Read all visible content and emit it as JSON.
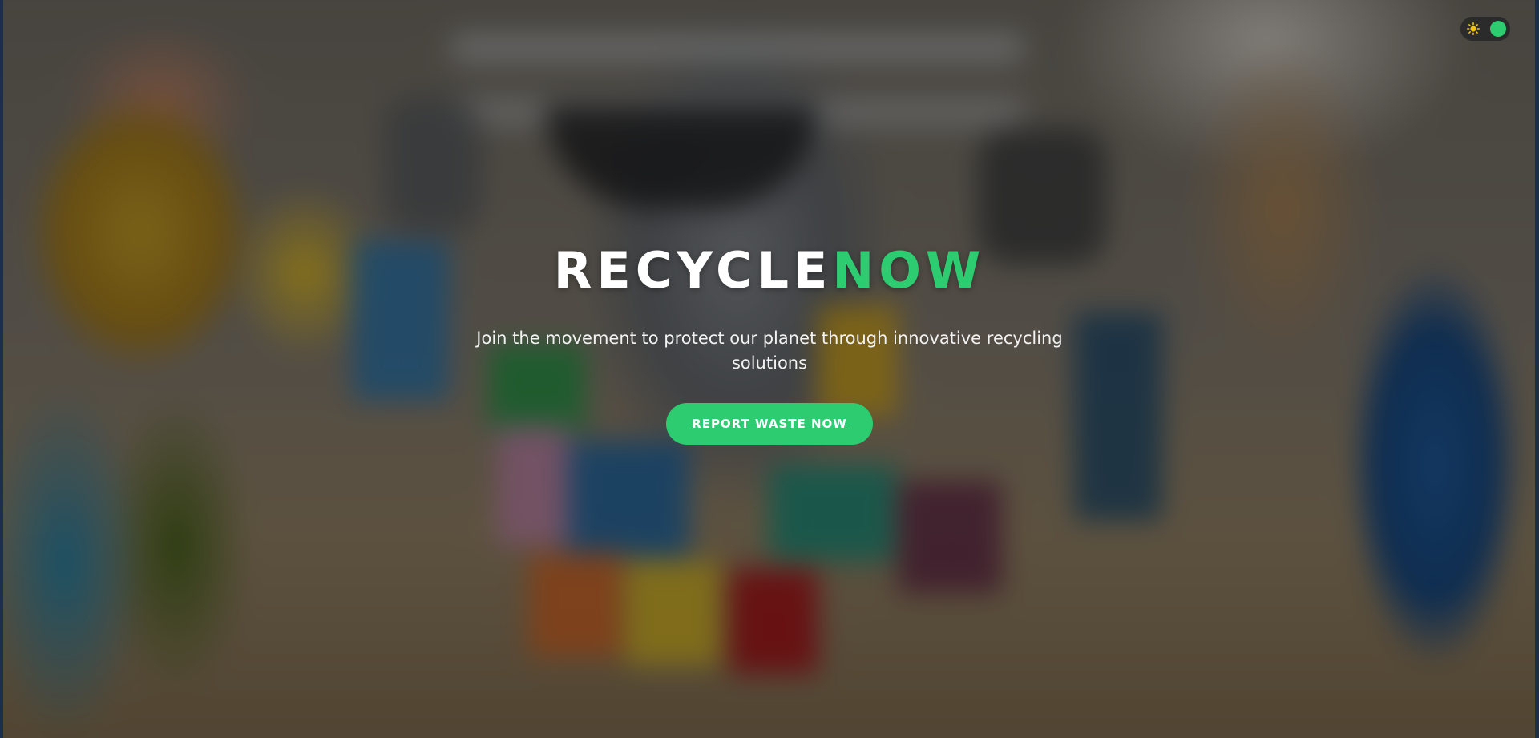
{
  "hero": {
    "title_main": "RECYCLE",
    "title_accent": "NOW",
    "subtitle": "Join the movement to protect our planet through innovative recycling solutions",
    "cta_label": "REPORT WASTE NOW"
  },
  "theme_toggle": {
    "icon": "sun-icon",
    "state": "light"
  },
  "colors": {
    "accent": "#2ecc71",
    "text": "#ffffff"
  }
}
